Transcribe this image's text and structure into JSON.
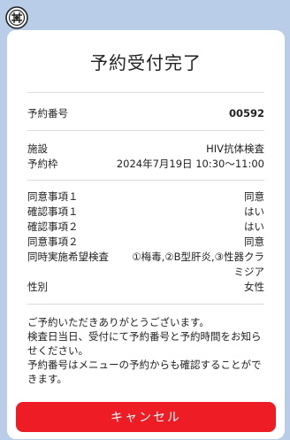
{
  "header": {
    "logo_icon": "emblem-icon"
  },
  "card": {
    "title": "予約受付完了",
    "reservation": {
      "label": "予約番号",
      "value": "00592"
    },
    "details": [
      {
        "label": "施設",
        "value": "HIV抗体検査"
      },
      {
        "label": "予約枠",
        "value": "2024年7月19日 10:30～11:00"
      }
    ],
    "consents": [
      {
        "label": "同意事項１",
        "value": "同意"
      },
      {
        "label": "確認事項１",
        "value": "はい"
      },
      {
        "label": "確認事項２",
        "value": "はい"
      },
      {
        "label": "同意事項２",
        "value": "同意"
      },
      {
        "label": "同時実施希望検査",
        "value": "①梅毒,②B型肝炎,③性器クラミジア"
      },
      {
        "label": "性別",
        "value": "女性"
      }
    ],
    "message": {
      "line1": "ご予約いただきありがとうございます。",
      "line2": "検査日当日、受付にて予約番号と予約時間をお知らせください。",
      "line3": "予約番号はメニューの予約からも確認することができます。"
    },
    "cancel_label": "キャンセル"
  },
  "colors": {
    "background": "#b9cde8",
    "button": "#ee1c25"
  }
}
